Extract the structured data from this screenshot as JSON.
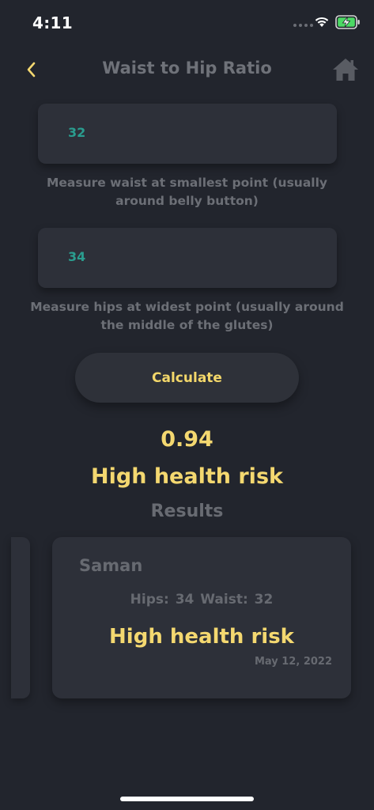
{
  "status_bar": {
    "time": "4:11",
    "signal_icon": "cellular-dots-icon",
    "wifi_icon": "wifi-icon",
    "battery_icon": "battery-charging-icon",
    "battery_color": "#4cd964"
  },
  "nav": {
    "title": "Waist to Hip Ratio",
    "back_icon": "chevron-left-icon",
    "home_icon": "home-icon",
    "accent": "#f4d870"
  },
  "form": {
    "waist_value": "32",
    "waist_hint": "Measure waist at smallest point (usually around belly button)",
    "hips_value": "34",
    "hips_hint": "Measure hips at widest point (usually around the middle of the glutes)",
    "calculate_label": "Calculate"
  },
  "result": {
    "ratio": "0.94",
    "risk_label": "High health risk"
  },
  "results_section": {
    "heading": "Results",
    "cards": [
      {
        "name": "Saman",
        "measurements": "Hips: 34  Waist: 32",
        "risk": "High health risk",
        "date": "May 12, 2022"
      }
    ]
  }
}
